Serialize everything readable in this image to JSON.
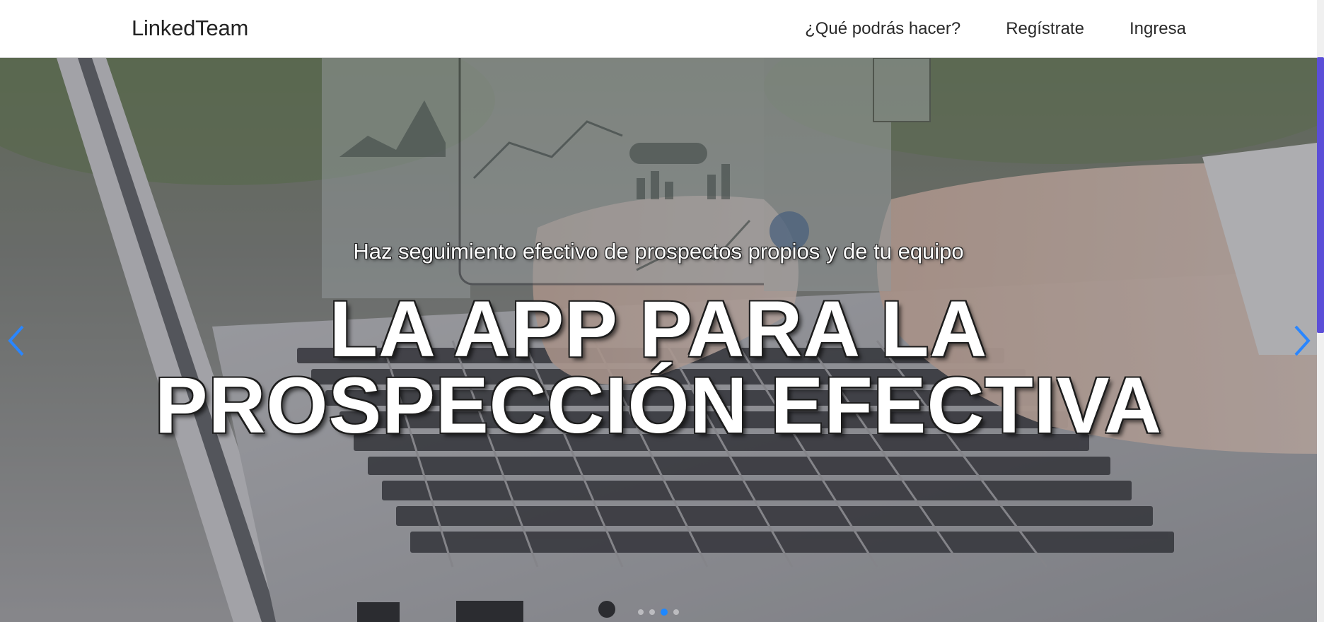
{
  "navbar": {
    "brand": "LinkedTeam",
    "links": [
      {
        "label": "¿Qué podrás hacer?"
      },
      {
        "label": "Regístrate"
      },
      {
        "label": "Ingresa"
      }
    ]
  },
  "hero": {
    "subtitle": "Haz seguimiento efectivo de prospectos propios y de tu equipo",
    "title_line1": "LA APP PARA LA",
    "title_line2": "PROSPECCIÓN EFECTIVA",
    "controls": {
      "prev_icon": "chevron-left-icon",
      "next_icon": "chevron-right-icon"
    },
    "indicators": {
      "count": 4,
      "active_index": 2
    },
    "colors": {
      "accent": "#1e88ff",
      "scroll_thumb": "#5b4ed8"
    }
  }
}
